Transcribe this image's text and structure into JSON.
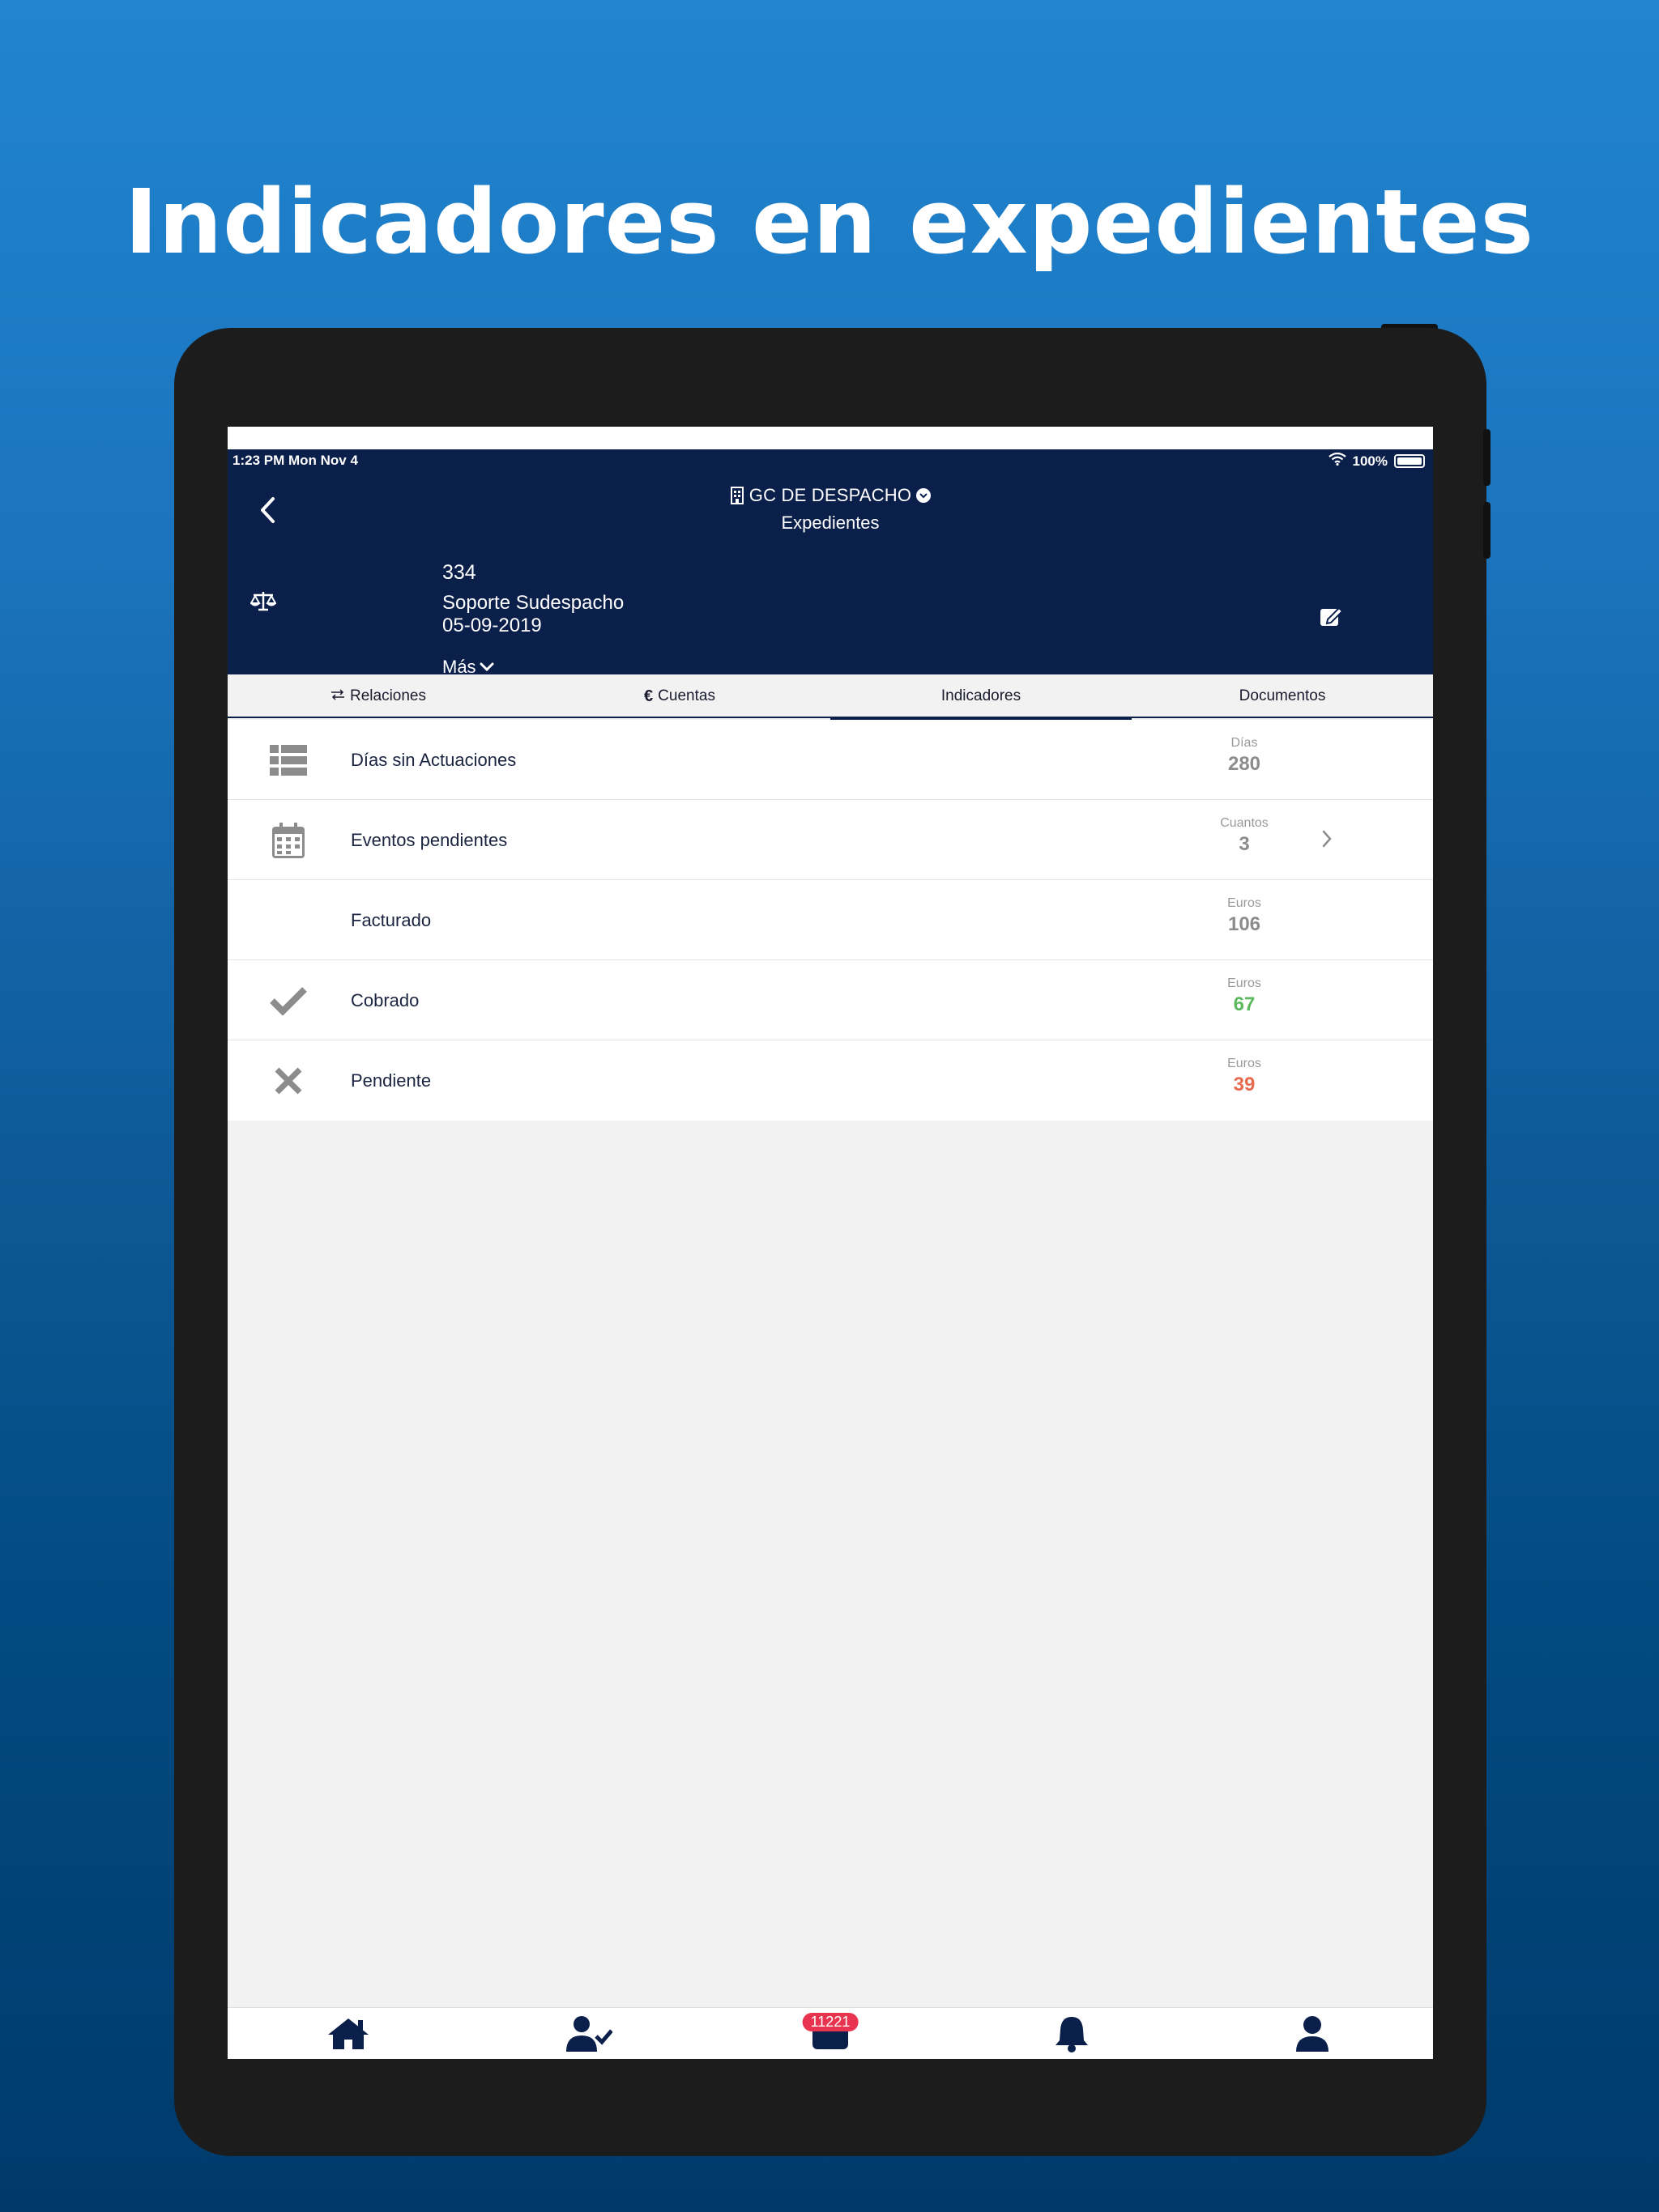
{
  "headline": "Indicadores en expedientes",
  "status_bar": {
    "time": "1:23 PM   Mon Nov 4",
    "battery": "100%"
  },
  "header": {
    "office": "GC DE DESPACHO",
    "section": "Expedientes",
    "file_number": "334",
    "client": "Soporte Sudespacho",
    "date": "05-09-2019",
    "more_label": "Más"
  },
  "tabs": [
    {
      "label": "Relaciones",
      "icon": "arrows-icon"
    },
    {
      "label": "Cuentas",
      "icon": "euro-icon"
    },
    {
      "label": "Indicadores",
      "active": true
    },
    {
      "label": "Documentos"
    }
  ],
  "rows": [
    {
      "label": "Días sin Actuaciones",
      "unit": "Días",
      "value": "280",
      "icon": "list-icon"
    },
    {
      "label": "Eventos pendientes",
      "unit": "Cuantos",
      "value": "3",
      "icon": "calendar-icon",
      "chevron": true
    },
    {
      "label": "Facturado",
      "unit": "Euros",
      "value": "106"
    },
    {
      "label": "Cobrado",
      "unit": "Euros",
      "value": "67",
      "icon": "check-icon",
      "color": "#5cb85c"
    },
    {
      "label": "Pendiente",
      "unit": "Euros",
      "value": "39",
      "icon": "x-icon",
      "color": "#e86a4e"
    }
  ],
  "tabbar": {
    "badge": "11221"
  },
  "colors": {
    "header_bg": "#0a1f4a",
    "accent_green": "#5cb85c",
    "accent_red": "#e86a4e",
    "badge": "#e8344e"
  }
}
